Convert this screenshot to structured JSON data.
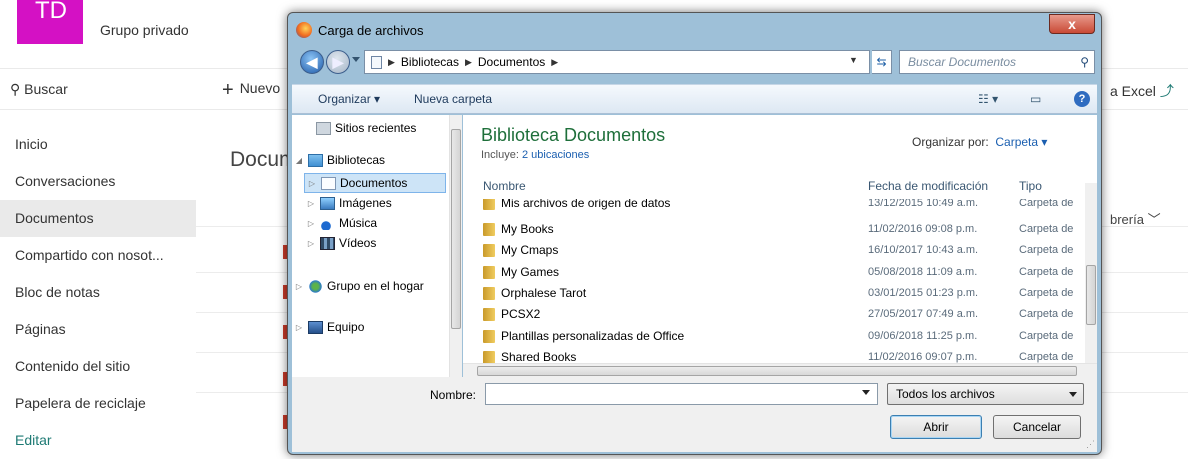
{
  "sharepoint": {
    "avatar_text": "TD",
    "group_name": "Grupo privado",
    "search_label": "Buscar",
    "new_label": "Nuevo",
    "excel_label": "a Excel",
    "page_title": "Docum",
    "column_partial": "brería",
    "nav": [
      "Inicio",
      "Conversaciones",
      "Documentos",
      "Compartido con nosot...",
      "Bloc de notas",
      "Páginas",
      "Contenido del sitio",
      "Papelera de reciclaje",
      "Editar"
    ],
    "active_nav": "Documentos"
  },
  "dialog": {
    "title": "Carga de archivos",
    "close_label": "x",
    "breadcrumb": [
      "Bibliotecas",
      "Documentos"
    ],
    "search_placeholder": "Buscar Documentos",
    "toolbar": {
      "organize": "Organizar ▾",
      "new_folder": "Nueva carpeta"
    },
    "tree": [
      {
        "label": "Sitios recientes",
        "icon": "recent-places-icon"
      },
      {
        "label": "Bibliotecas",
        "icon": "libraries-icon"
      },
      {
        "label": "Documentos",
        "icon": "documents-icon",
        "selected": true
      },
      {
        "label": "Imágenes",
        "icon": "pictures-icon"
      },
      {
        "label": "Música",
        "icon": "music-icon"
      },
      {
        "label": "Vídeos",
        "icon": "videos-icon"
      },
      {
        "label": "Grupo en el hogar",
        "icon": "homegroup-icon"
      },
      {
        "label": "Equipo",
        "icon": "computer-icon"
      }
    ],
    "library_title": "Biblioteca Documentos",
    "library_includes_label": "Incluye:",
    "library_includes_link": "2 ubicaciones",
    "organize_by_label": "Organizar por:",
    "organize_by_value": "Carpeta ▾",
    "columns": {
      "name": "Nombre",
      "date": "Fecha de modificación",
      "type": "Tipo"
    },
    "files": [
      {
        "name": "Mis archivos de origen de datos",
        "date": "13/12/2015 10:49 a.m.",
        "type": "Carpeta de"
      },
      {
        "name": "My Books",
        "date": "11/02/2016 09:08 p.m.",
        "type": "Carpeta de"
      },
      {
        "name": "My Cmaps",
        "date": "16/10/2017 10:43 a.m.",
        "type": "Carpeta de"
      },
      {
        "name": "My Games",
        "date": "05/08/2018 11:09 a.m.",
        "type": "Carpeta de"
      },
      {
        "name": "Orphalese Tarot",
        "date": "03/01/2015 01:23 p.m.",
        "type": "Carpeta de"
      },
      {
        "name": "PCSX2",
        "date": "27/05/2017 07:49 a.m.",
        "type": "Carpeta de"
      },
      {
        "name": "Plantillas personalizadas de Office",
        "date": "09/06/2018 11:25 p.m.",
        "type": "Carpeta de"
      },
      {
        "name": "Shared Books",
        "date": "11/02/2016 09:07 p.m.",
        "type": "Carpeta de"
      }
    ],
    "filename_label": "Nombre:",
    "filename_value": "",
    "filter_value": "Todos los archivos",
    "open_label": "Abrir",
    "cancel_label": "Cancelar"
  }
}
